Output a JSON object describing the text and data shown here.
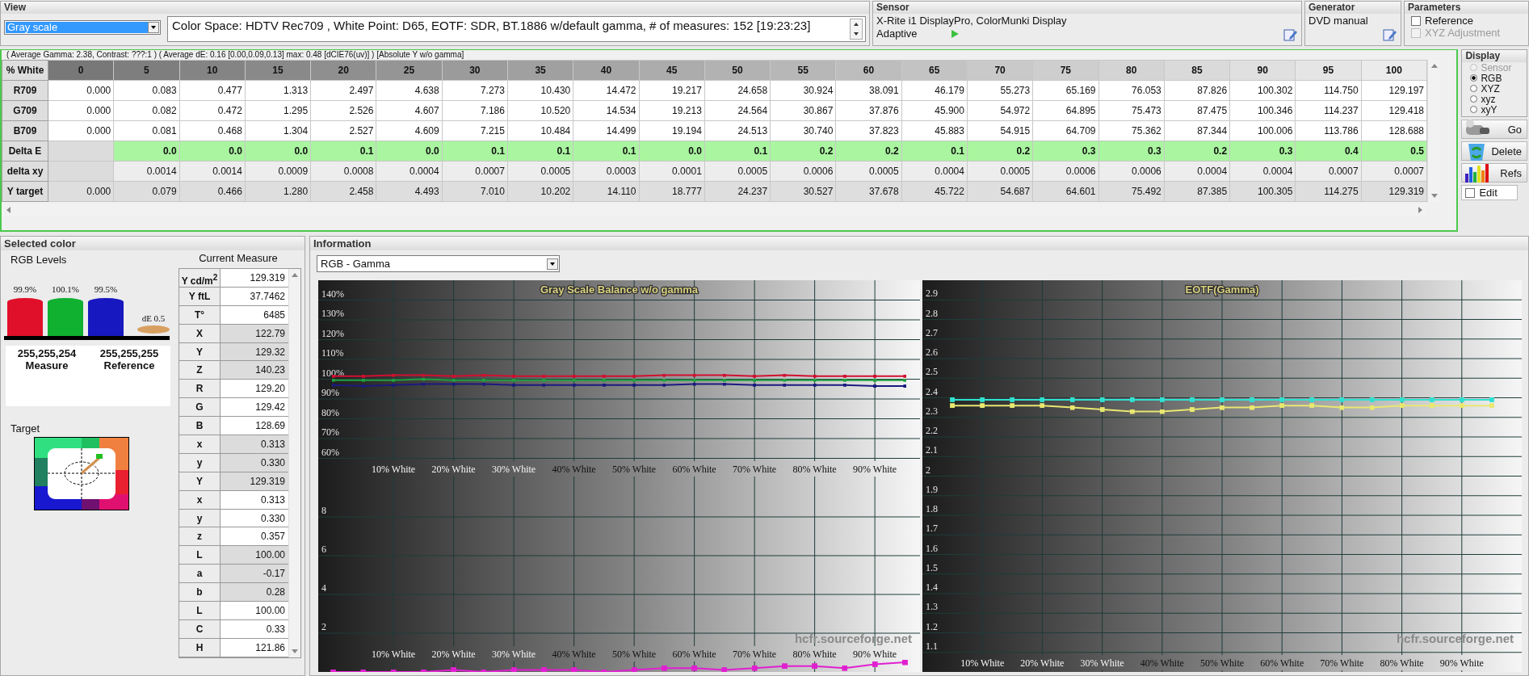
{
  "view": {
    "title": "View",
    "mode": "Gray scale",
    "info": "Color Space: HDTV Rec709 , White Point: D65, EOTF:  SDR, BT.1886 w/default gamma, # of measures: 152 [19:23:23]"
  },
  "sensor": {
    "title": "Sensor",
    "name": "X-Rite i1 DisplayPro, ColorMunki Display",
    "mode": "Adaptive"
  },
  "generator": {
    "title": "Generator",
    "name": "DVD manual"
  },
  "parameters": {
    "title": "Parameters",
    "options": [
      {
        "label": "Reference",
        "checked": false,
        "disabled": false
      },
      {
        "label": "XYZ Adjustment",
        "checked": false,
        "disabled": true
      }
    ]
  },
  "summary": "( Average Gamma: 2.38, Contrast: ???:1 ) ( Average dE: 0.16 [0.00,0.09,0.13] max: 0.48 [dCIE76(uv)] ) [Absolute Y w/o gamma]",
  "table": {
    "corner": "% White",
    "columns": [
      "0",
      "5",
      "10",
      "15",
      "20",
      "25",
      "30",
      "35",
      "40",
      "45",
      "50",
      "55",
      "60",
      "65",
      "70",
      "75",
      "80",
      "85",
      "90",
      "95",
      "100"
    ],
    "rows": [
      {
        "label": "R709",
        "kind": "value",
        "cells": [
          "0.000",
          "0.083",
          "0.477",
          "1.313",
          "2.497",
          "4.638",
          "7.273",
          "10.430",
          "14.472",
          "19.217",
          "24.658",
          "30.924",
          "38.091",
          "46.179",
          "55.273",
          "65.169",
          "76.053",
          "87.826",
          "100.302",
          "114.750",
          "129.197"
        ]
      },
      {
        "label": "G709",
        "kind": "value",
        "cells": [
          "0.000",
          "0.082",
          "0.472",
          "1.295",
          "2.526",
          "4.607",
          "7.186",
          "10.520",
          "14.534",
          "19.213",
          "24.564",
          "30.867",
          "37.876",
          "45.900",
          "54.972",
          "64.895",
          "75.473",
          "87.475",
          "100.346",
          "114.237",
          "129.418"
        ]
      },
      {
        "label": "B709",
        "kind": "value",
        "cells": [
          "0.000",
          "0.081",
          "0.468",
          "1.304",
          "2.527",
          "4.609",
          "7.215",
          "10.484",
          "14.499",
          "19.194",
          "24.513",
          "30.740",
          "37.823",
          "45.883",
          "54.915",
          "64.709",
          "75.362",
          "87.344",
          "100.006",
          "113.786",
          "128.688"
        ]
      },
      {
        "label": "Delta E",
        "kind": "delta_e",
        "cells": [
          null,
          "0.0",
          "0.0",
          "0.0",
          "0.1",
          "0.0",
          "0.1",
          "0.1",
          "0.1",
          "0.0",
          "0.1",
          "0.2",
          "0.2",
          "0.1",
          "0.2",
          "0.3",
          "0.3",
          "0.2",
          "0.3",
          "0.4",
          "0.5"
        ]
      },
      {
        "label": "delta xy",
        "kind": "delta_xy",
        "cells": [
          null,
          "0.0014",
          "0.0014",
          "0.0009",
          "0.0008",
          "0.0004",
          "0.0007",
          "0.0005",
          "0.0003",
          "0.0001",
          "0.0005",
          "0.0006",
          "0.0005",
          "0.0004",
          "0.0005",
          "0.0006",
          "0.0006",
          "0.0004",
          "0.0004",
          "0.0007",
          "0.0007"
        ]
      },
      {
        "label": "Y target",
        "kind": "target",
        "cells": [
          "0.000",
          "0.079",
          "0.466",
          "1.280",
          "2.458",
          "4.493",
          "7.010",
          "10.202",
          "14.110",
          "18.777",
          "24.237",
          "30.527",
          "37.678",
          "45.722",
          "54.687",
          "64.601",
          "75.492",
          "87.385",
          "100.305",
          "114.275",
          "129.319"
        ]
      }
    ]
  },
  "display": {
    "title": "Display",
    "options": [
      {
        "label": "Sensor",
        "selected": false,
        "disabled": true
      },
      {
        "label": "RGB",
        "selected": true,
        "disabled": false
      },
      {
        "label": "XYZ",
        "selected": false,
        "disabled": false
      },
      {
        "label": "xyz",
        "selected": false,
        "disabled": false
      },
      {
        "label": "xyY",
        "selected": false,
        "disabled": false
      }
    ]
  },
  "actions": [
    {
      "label": "Go",
      "kind": "go"
    },
    {
      "label": "Delete",
      "kind": "delete"
    },
    {
      "label": "Refs",
      "kind": "refs"
    }
  ],
  "edit": {
    "label": "Edit",
    "checked": false
  },
  "selected_color": {
    "title": "Selected color",
    "levels_title": "RGB Levels",
    "levels": [
      {
        "label": "99.9%",
        "color": "#e0102a"
      },
      {
        "label": "100.1%",
        "color": "#10b030"
      },
      {
        "label": "99.5%",
        "color": "#1818c0"
      }
    ],
    "delta_label": "dE 0.5",
    "measure": {
      "value": "255,255,254",
      "label": "Measure"
    },
    "reference": {
      "value": "255,255,255",
      "label": "Reference"
    },
    "target_title": "Target"
  },
  "current_measure": {
    "title": "Current Measure",
    "rows": [
      {
        "label": "Y cd/m$^{2}$",
        "value": "129.319",
        "shaded": false
      },
      {
        "label": "Y ftL",
        "value": "37.7462",
        "shaded": false
      },
      {
        "label": "T°",
        "value": "6485",
        "shaded": false
      },
      {
        "label": "X",
        "value": "122.79",
        "shaded": true
      },
      {
        "label": "Y",
        "value": "129.32",
        "shaded": true
      },
      {
        "label": "Z",
        "value": "140.23",
        "shaded": true
      },
      {
        "label": "R",
        "value": "129.20",
        "shaded": false
      },
      {
        "label": "G",
        "value": "129.42",
        "shaded": false
      },
      {
        "label": "B",
        "value": "128.69",
        "shaded": false
      },
      {
        "label": "x",
        "value": "0.313",
        "shaded": true
      },
      {
        "label": "y",
        "value": "0.330",
        "shaded": true
      },
      {
        "label": "Y",
        "value": "129.319",
        "shaded": true
      },
      {
        "label": "x",
        "value": "0.313",
        "shaded": false
      },
      {
        "label": "y",
        "value": "0.330",
        "shaded": false
      },
      {
        "label": "z",
        "value": "0.357",
        "shaded": false
      },
      {
        "label": "L",
        "value": "100.00",
        "shaded": true
      },
      {
        "label": "a",
        "value": "-0.17",
        "shaded": true
      },
      {
        "label": "b",
        "value": "0.28",
        "shaded": true
      },
      {
        "label": "L",
        "value": "100.00",
        "shaded": false
      },
      {
        "label": "C",
        "value": "0.33",
        "shaded": false
      },
      {
        "label": "H",
        "value": "121.86",
        "shaded": false
      }
    ]
  },
  "information": {
    "title": "Information",
    "mode": "RGB - Gamma",
    "charts": [
      {
        "kind": "balance",
        "chart_data": {
          "type": "line",
          "grid": true,
          "title": "Gray Scale Balance w/o gamma",
          "x": [
            0,
            5,
            10,
            15,
            20,
            25,
            30,
            35,
            40,
            45,
            50,
            55,
            60,
            65,
            70,
            75,
            80,
            85,
            90,
            95
          ],
          "xlim": [
            -2.5,
            97.5
          ],
          "ylim": [
            50,
            150
          ],
          "yticks": [
            {
              "value": 60,
              "label": "60%"
            },
            {
              "value": 70,
              "label": "70%"
            },
            {
              "value": 80,
              "label": "80%"
            },
            {
              "value": 90,
              "label": "90%"
            },
            {
              "value": 100,
              "label": "100%"
            },
            {
              "value": 110,
              "label": "110%"
            },
            {
              "value": 120,
              "label": "120%"
            },
            {
              "value": 130,
              "label": "130%"
            },
            {
              "value": 140,
              "label": "140%"
            }
          ],
          "xticks": [
            {
              "value": 10,
              "label": "10% White"
            },
            {
              "value": 20,
              "label": "20% White"
            },
            {
              "value": 30,
              "label": "30% White"
            },
            {
              "value": 40,
              "label": "40% White"
            },
            {
              "value": 50,
              "label": "50% White"
            },
            {
              "value": 60,
              "label": "60% White"
            },
            {
              "value": 70,
              "label": "70% White"
            },
            {
              "value": 80,
              "label": "80% White"
            },
            {
              "value": 90,
              "label": "90% White"
            }
          ],
          "series": [
            {
              "color": "#d01030",
              "values": [
                101.5,
                101.5,
                102,
                102,
                101.5,
                102,
                101.5,
                101.5,
                101.5,
                101.5,
                101.5,
                102,
                102,
                102,
                101.5,
                102,
                101.5,
                101.5,
                101.5,
                101.5
              ]
            },
            {
              "color": "#20a040",
              "values": [
                99.5,
                99.5,
                99.5,
                100,
                99.5,
                99.5,
                99.5,
                99.5,
                99.5,
                99.5,
                99.5,
                99.5,
                99.5,
                99.5,
                99.5,
                99.5,
                99.5,
                99.5,
                99.5,
                99.5
              ]
            },
            {
              "color": "#1a1a80",
              "values": [
                97,
                96.5,
                97,
                97.5,
                97.5,
                97.5,
                97,
                97,
                97,
                97,
                97,
                97,
                97.5,
                97.5,
                97,
                97,
                97,
                97,
                96.5,
                96.5
              ]
            }
          ]
        }
      },
      {
        "kind": "delta_e",
        "credit": "hcfr.sourceforge.net",
        "chart_data": {
          "type": "line",
          "grid": true,
          "x": [
            0,
            5,
            10,
            15,
            20,
            25,
            30,
            35,
            40,
            45,
            50,
            55,
            60,
            65,
            70,
            75,
            80,
            85,
            90,
            95
          ],
          "xlim": [
            -2.5,
            97.5
          ],
          "ylim": [
            0,
            10
          ],
          "yticks": [
            2,
            4,
            6,
            8
          ],
          "xticks": [
            {
              "value": 10,
              "label": "10% White"
            },
            {
              "value": 20,
              "label": "20% White"
            },
            {
              "value": 30,
              "label": "30% White"
            },
            {
              "value": 40,
              "label": "40% White"
            },
            {
              "value": 50,
              "label": "50% White"
            },
            {
              "value": 60,
              "label": "60% White"
            },
            {
              "value": 70,
              "label": "70% White"
            },
            {
              "value": 80,
              "label": "80% White"
            },
            {
              "value": 90,
              "label": "90% White"
            }
          ],
          "series": [
            {
              "color": "#e020d0",
              "values": [
                0.0,
                0.0,
                0.0,
                0.0,
                0.1,
                0.0,
                0.1,
                0.1,
                0.1,
                0.0,
                0.1,
                0.2,
                0.2,
                0.1,
                0.2,
                0.3,
                0.3,
                0.2,
                0.4,
                0.5
              ]
            }
          ]
        }
      },
      {
        "kind": "eotf",
        "credit": "hcfr.sourceforge.net",
        "chart_data": {
          "type": "line",
          "grid": true,
          "title": "EOTF(Gamma)",
          "x": [
            5,
            10,
            15,
            20,
            25,
            30,
            35,
            40,
            45,
            50,
            55,
            60,
            65,
            70,
            75,
            80,
            85,
            90,
            95
          ],
          "xlim": [
            0,
            100
          ],
          "ylim": [
            1,
            3
          ],
          "yticks": [
            1.1,
            1.2,
            1.3,
            1.4,
            1.5,
            1.6,
            1.7,
            1.8,
            1.9,
            2,
            2.1,
            2.2,
            2.3,
            2.4,
            2.5,
            2.6,
            2.7,
            2.8,
            2.9
          ],
          "xticks": [
            {
              "value": 10,
              "label": "10% White"
            },
            {
              "value": 20,
              "label": "20% White"
            },
            {
              "value": 30,
              "label": "30% White"
            },
            {
              "value": 40,
              "label": "40% White"
            },
            {
              "value": 50,
              "label": "50% White"
            },
            {
              "value": 60,
              "label": "60% White"
            },
            {
              "value": 70,
              "label": "70% White"
            },
            {
              "value": 80,
              "label": "80% White"
            },
            {
              "value": 90,
              "label": "90% White"
            }
          ],
          "series": [
            {
              "color": "#e8e870",
              "values": [
                2.36,
                2.36,
                2.36,
                2.36,
                2.35,
                2.34,
                2.33,
                2.33,
                2.34,
                2.35,
                2.35,
                2.36,
                2.36,
                2.35,
                2.35,
                2.36,
                2.36,
                2.36,
                2.36
              ]
            },
            {
              "color": "#30e0d0",
              "values": [
                2.39,
                2.39,
                2.39,
                2.39,
                2.39,
                2.39,
                2.39,
                2.39,
                2.39,
                2.39,
                2.39,
                2.39,
                2.39,
                2.39,
                2.39,
                2.39,
                2.39,
                2.39,
                2.39
              ]
            }
          ]
        }
      }
    ]
  }
}
